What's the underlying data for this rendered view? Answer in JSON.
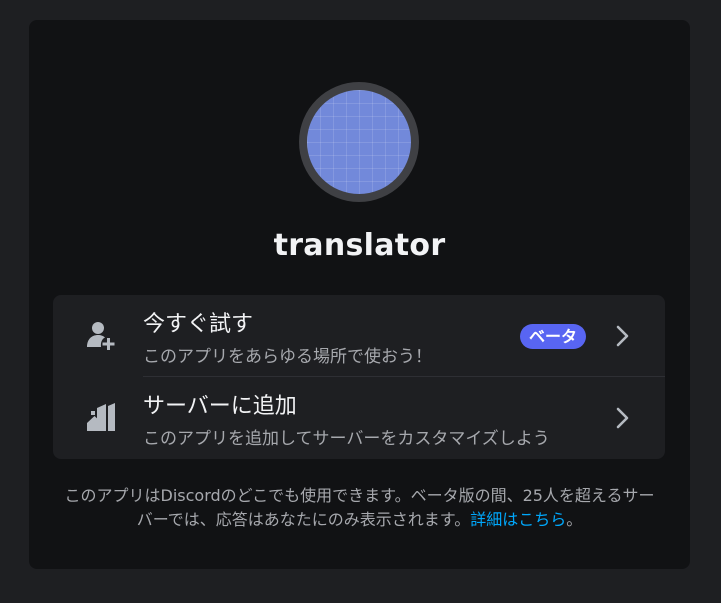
{
  "app": {
    "name": "translator"
  },
  "options": [
    {
      "title": "今すぐ試す",
      "subtitle": "このアプリをあらゆる場所で使おう！",
      "badge": "ベータ",
      "icon": "user-add-icon"
    },
    {
      "title": "サーバーに追加",
      "subtitle": "このアプリを追加してサーバーをカスタマイズしよう",
      "icon": "server-add-icon"
    }
  ],
  "footer": {
    "text": "このアプリはDiscordのどこでも使用できます。ベータ版の間、25人を超えるサーバーでは、応答はあなたにのみ表示されます。",
    "link_text": "詳細はこちら",
    "suffix": "。"
  },
  "colors": {
    "accent": "#5865f2",
    "link": "#00a8fc",
    "avatar": "#7289da"
  }
}
